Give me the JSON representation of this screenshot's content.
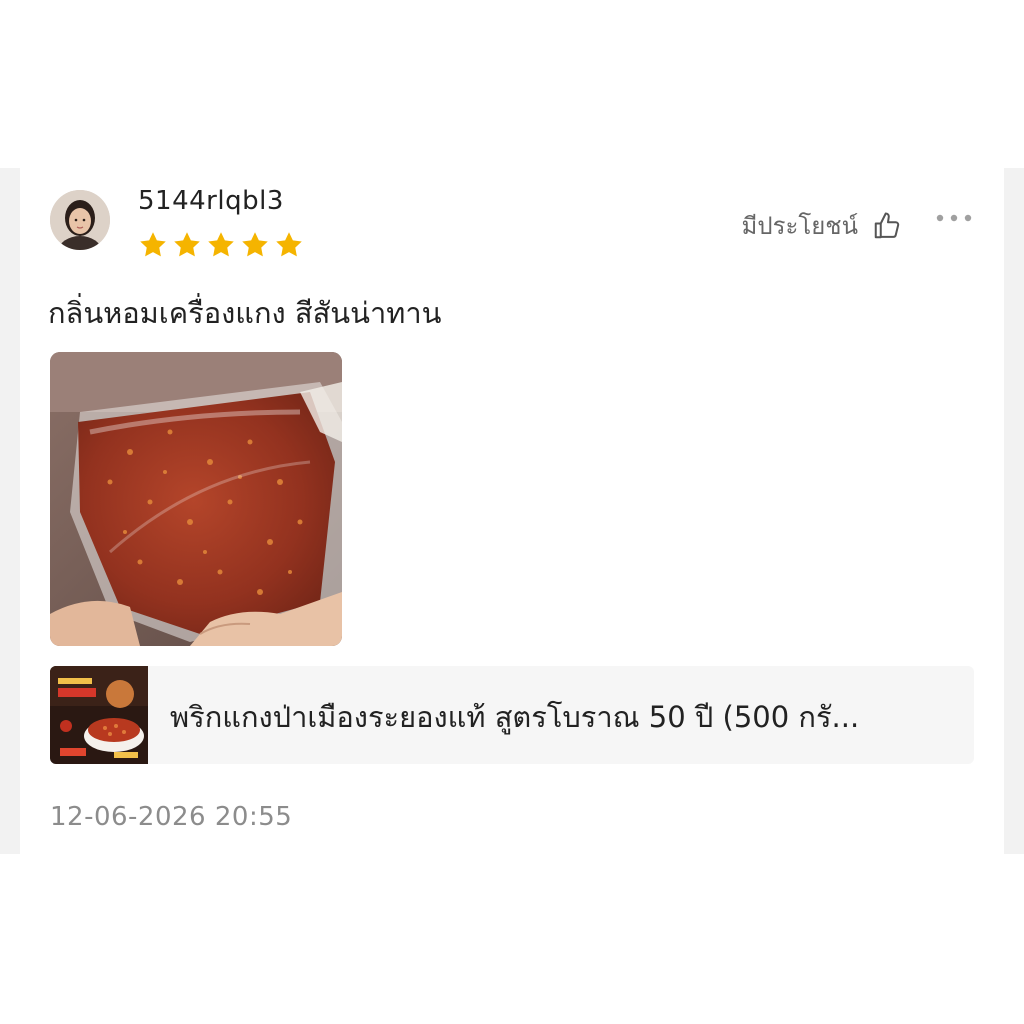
{
  "review": {
    "username": "5144rlqbl3",
    "rating": 5,
    "helpful_label": "มีประโยชน์",
    "text": "กลิ่นหอมเครื่องแกง สีสันน่าทาน",
    "timestamp": "12-06-2026 20:55"
  },
  "product": {
    "name": "พริกแกงป่าเมืองระยองแท้ สูตรโบราณ 50 ปี (500 กรั..."
  },
  "icons": {
    "star": "star-icon",
    "helpful": "thumbs-up-icon",
    "more": "more-options-icon"
  },
  "colors": {
    "star": "#f5b400",
    "muted_text": "#8c8c8c",
    "product_bg": "#f6f6f6"
  }
}
